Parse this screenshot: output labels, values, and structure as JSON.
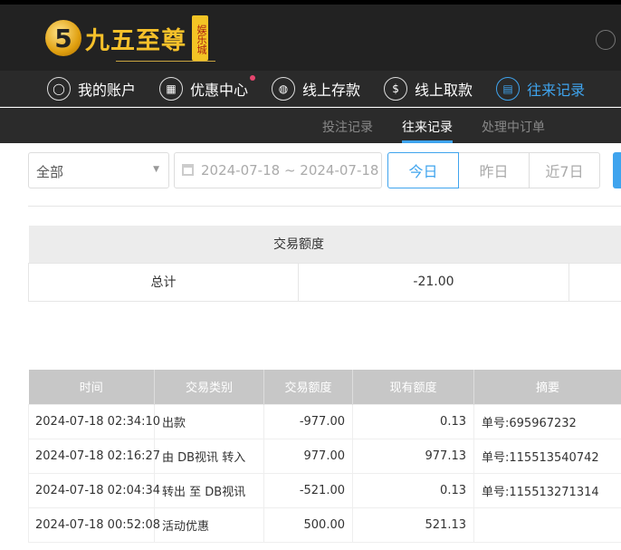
{
  "brand": {
    "logo_text": "九五至尊",
    "badge": "娱乐城"
  },
  "nav": [
    {
      "label": "我的账户",
      "icon": "user-icon"
    },
    {
      "label": "优惠中心",
      "icon": "gift-icon"
    },
    {
      "label": "线上存款",
      "icon": "deposit-icon"
    },
    {
      "label": "线上取款",
      "icon": "withdraw-icon"
    },
    {
      "label": "往来记录",
      "icon": "record-icon",
      "active": true
    }
  ],
  "subnav": [
    {
      "label": "投注记录"
    },
    {
      "label": "往来记录",
      "active": true
    },
    {
      "label": "处理中订单"
    }
  ],
  "filters": {
    "type": "全部",
    "date_range": "2024-07-18 ~ 2024-07-18",
    "quick": [
      "今日",
      "昨日",
      "近7日"
    ],
    "selected_quick": "今日"
  },
  "summary": {
    "header": "交易额度",
    "row_label": "总计",
    "amount": "-21.00"
  },
  "table": {
    "headers": [
      "时间",
      "交易类别",
      "交易额度",
      "现有额度",
      "摘要"
    ],
    "rows": [
      [
        "2024-07-18 02:34:10",
        "出款",
        "-977.00",
        "0.13",
        "单号:695967232"
      ],
      [
        "2024-07-18 02:16:27",
        "由 DB视讯 转入",
        "977.00",
        "977.13",
        "单号:115513540742"
      ],
      [
        "2024-07-18 02:04:34",
        "转出 至 DB视讯",
        "-521.00",
        "0.13",
        "单号:115513271314"
      ],
      [
        "2024-07-18 00:52:08",
        "活动优惠",
        "500.00",
        "521.13",
        ""
      ]
    ]
  },
  "colors": {
    "accent": "#3fa4ee",
    "header_bg": "#222222",
    "gold": "#f5c02a"
  }
}
